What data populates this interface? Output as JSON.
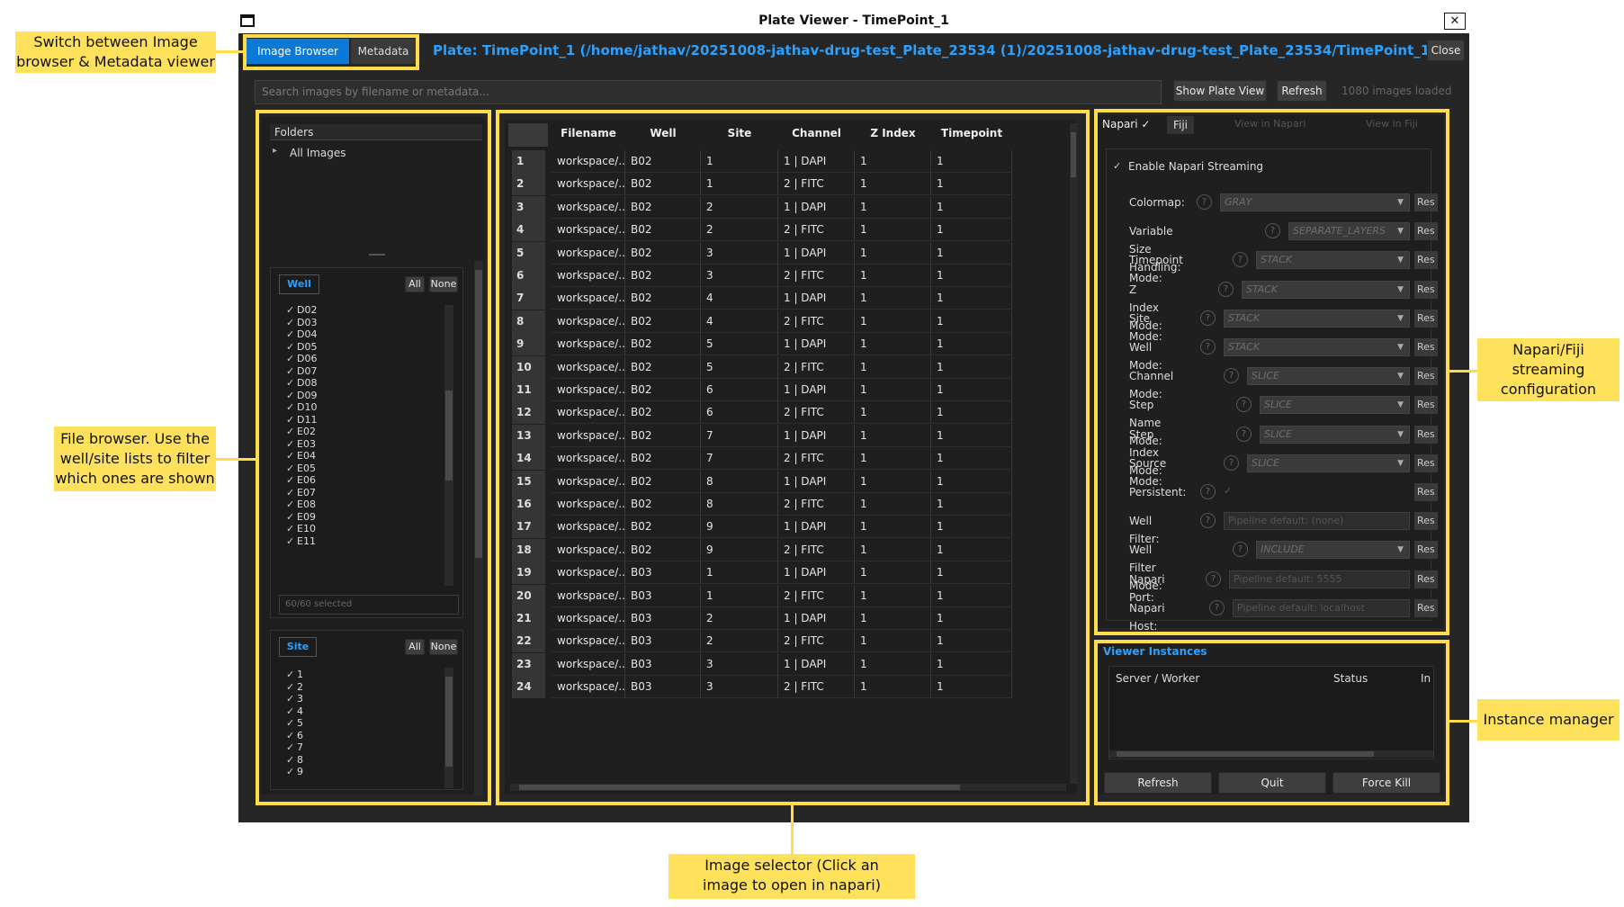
{
  "window": {
    "title": "Plate Viewer - TimePoint_1",
    "close_glyph": "✕"
  },
  "header": {
    "tabs": [
      "Image Browser",
      "Metadata"
    ],
    "plate_title": "Plate: TimePoint_1 (/home/jathav/20251008-jathav-drug-test_Plate_23534 (1)/20251008-jathav-drug-test_Plate_23534/TimePoint_1)",
    "close_label": "Close"
  },
  "search": {
    "placeholder": "Search images by filename or metadata...",
    "show_plate_label": "Show Plate View",
    "refresh_label": "Refresh",
    "status": "1080 images loaded"
  },
  "folders": {
    "header": "Folders",
    "root": "All Images"
  },
  "well_filter": {
    "label": "Well",
    "all_label": "All",
    "none_label": "None",
    "items": [
      "D02",
      "D03",
      "D04",
      "D05",
      "D06",
      "D07",
      "D08",
      "D09",
      "D10",
      "D11",
      "E02",
      "E03",
      "E04",
      "E05",
      "E06",
      "E07",
      "E08",
      "E09",
      "E10",
      "E11"
    ],
    "count_text": "60/60 selected"
  },
  "site_filter": {
    "label": "Site",
    "all_label": "All",
    "none_label": "None",
    "items": [
      "1",
      "2",
      "3",
      "4",
      "5",
      "6",
      "7",
      "8",
      "9"
    ]
  },
  "table": {
    "columns": [
      "Filename",
      "Well",
      "Site",
      "Channel",
      "Z Index",
      "Timepoint"
    ],
    "rows": [
      [
        "1",
        "workspace/...",
        "B02",
        "1",
        "1 | DAPI",
        "1",
        "1"
      ],
      [
        "2",
        "workspace/...",
        "B02",
        "1",
        "2 | FITC",
        "1",
        "1"
      ],
      [
        "3",
        "workspace/...",
        "B02",
        "2",
        "1 | DAPI",
        "1",
        "1"
      ],
      [
        "4",
        "workspace/...",
        "B02",
        "2",
        "2 | FITC",
        "1",
        "1"
      ],
      [
        "5",
        "workspace/...",
        "B02",
        "3",
        "1 | DAPI",
        "1",
        "1"
      ],
      [
        "6",
        "workspace/...",
        "B02",
        "3",
        "2 | FITC",
        "1",
        "1"
      ],
      [
        "7",
        "workspace/...",
        "B02",
        "4",
        "1 | DAPI",
        "1",
        "1"
      ],
      [
        "8",
        "workspace/...",
        "B02",
        "4",
        "2 | FITC",
        "1",
        "1"
      ],
      [
        "9",
        "workspace/...",
        "B02",
        "5",
        "1 | DAPI",
        "1",
        "1"
      ],
      [
        "10",
        "workspace/...",
        "B02",
        "5",
        "2 | FITC",
        "1",
        "1"
      ],
      [
        "11",
        "workspace/...",
        "B02",
        "6",
        "1 | DAPI",
        "1",
        "1"
      ],
      [
        "12",
        "workspace/...",
        "B02",
        "6",
        "2 | FITC",
        "1",
        "1"
      ],
      [
        "13",
        "workspace/...",
        "B02",
        "7",
        "1 | DAPI",
        "1",
        "1"
      ],
      [
        "14",
        "workspace/...",
        "B02",
        "7",
        "2 | FITC",
        "1",
        "1"
      ],
      [
        "15",
        "workspace/...",
        "B02",
        "8",
        "1 | DAPI",
        "1",
        "1"
      ],
      [
        "16",
        "workspace/...",
        "B02",
        "8",
        "2 | FITC",
        "1",
        "1"
      ],
      [
        "17",
        "workspace/...",
        "B02",
        "9",
        "1 | DAPI",
        "1",
        "1"
      ],
      [
        "18",
        "workspace/...",
        "B02",
        "9",
        "2 | FITC",
        "1",
        "1"
      ],
      [
        "19",
        "workspace/...",
        "B03",
        "1",
        "1 | DAPI",
        "1",
        "1"
      ],
      [
        "20",
        "workspace/...",
        "B03",
        "1",
        "2 | FITC",
        "1",
        "1"
      ],
      [
        "21",
        "workspace/...",
        "B03",
        "2",
        "1 | DAPI",
        "1",
        "1"
      ],
      [
        "22",
        "workspace/...",
        "B03",
        "2",
        "2 | FITC",
        "1",
        "1"
      ],
      [
        "23",
        "workspace/...",
        "B03",
        "3",
        "1 | DAPI",
        "1",
        "1"
      ],
      [
        "24",
        "workspace/...",
        "B03",
        "3",
        "2 | FITC",
        "1",
        "1"
      ]
    ]
  },
  "viewer_tabs": {
    "napari": "Napari ✓",
    "fiji": "Fiji",
    "view_napari": "View in Napari",
    "view_fiji": "View in Fiji"
  },
  "napari": {
    "enable_label": "Enable Napari Streaming",
    "help_glyph": "?",
    "reset_label": "Res",
    "settings": [
      {
        "label": "Colormap:",
        "value": "GRAY",
        "kind": "combo"
      },
      {
        "label": "Variable Size Handling:",
        "value": "SEPARATE_LAYERS",
        "kind": "combo"
      },
      {
        "label": "Timepoint Mode:",
        "value": "STACK",
        "kind": "combo"
      },
      {
        "label": "Z Index Mode:",
        "value": "STACK",
        "kind": "combo"
      },
      {
        "label": "Site Mode:",
        "value": "STACK",
        "kind": "combo"
      },
      {
        "label": "Well Mode:",
        "value": "STACK",
        "kind": "combo"
      },
      {
        "label": "Channel Mode:",
        "value": "SLICE",
        "kind": "combo"
      },
      {
        "label": "Step Name Mode:",
        "value": "SLICE",
        "kind": "combo"
      },
      {
        "label": "Step Index Mode:",
        "value": "SLICE",
        "kind": "combo"
      },
      {
        "label": "Source Mode:",
        "value": "SLICE",
        "kind": "combo"
      },
      {
        "label": "Persistent:",
        "value": "✓",
        "kind": "check"
      },
      {
        "label": "Well Filter:",
        "value": "Pipeline default: (none)",
        "kind": "field"
      },
      {
        "label": "Well Filter Mode:",
        "value": "INCLUDE",
        "kind": "combo"
      },
      {
        "label": "Napari Port:",
        "value": "Pipeline default: 5555",
        "kind": "field"
      },
      {
        "label": "Napari Host:",
        "value": "Pipeline default: localhost",
        "kind": "field"
      }
    ]
  },
  "instances": {
    "title": "Viewer Instances",
    "columns": [
      "Server / Worker",
      "Status",
      "In"
    ],
    "buttons": [
      "Refresh",
      "Quit",
      "Force Kill"
    ]
  },
  "annotations": {
    "switch": "Switch between Image browser & Metadata viewer",
    "file_browser": "File browser. Use the well/site lists to filter which ones are shown",
    "napari_config": "Napari/Fiji streaming configuration",
    "instance_manager": "Instance manager",
    "image_selector": "Image selector (Click an image to open in napari)"
  },
  "colors": {
    "accent": "#0a7ad6",
    "plate_title": "#2aa0ff",
    "highlight": "#ffdc4a",
    "callout_bg": "#ffe15c",
    "window_bg": "#262626"
  }
}
